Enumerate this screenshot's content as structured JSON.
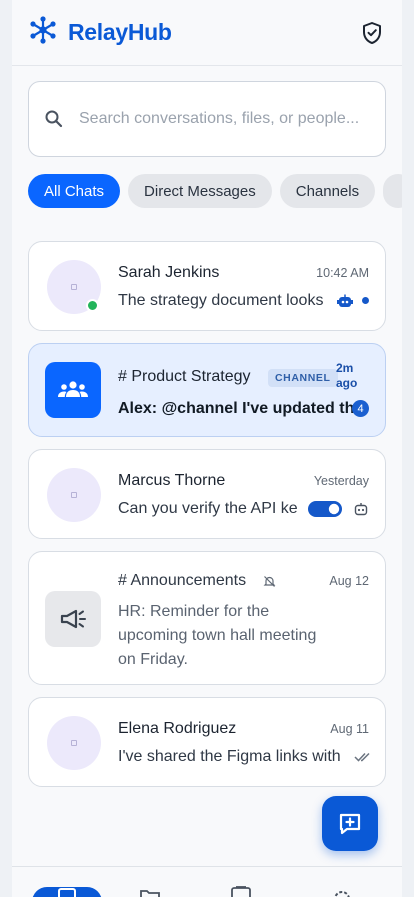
{
  "app": {
    "title": "RelayHub"
  },
  "search": {
    "placeholder": "Search conversations, files, or people..."
  },
  "filters": [
    {
      "label": "All Chats",
      "active": true
    },
    {
      "label": "Direct Messages",
      "active": false
    },
    {
      "label": "Channels",
      "active": false
    }
  ],
  "conversations": [
    {
      "name": "Sarah Jenkins",
      "time": "10:42 AM",
      "preview": "The strategy document looks",
      "online": true,
      "unread": true
    },
    {
      "name": "# Product Strategy",
      "badge": "CHANNEL",
      "time": "2m ago",
      "preview": "Alex: @channel I've updated the",
      "unread_count": "4"
    },
    {
      "name": "Marcus Thorne",
      "time": "Yesterday",
      "preview": "Can you verify the API ke"
    },
    {
      "name": "# Announcements",
      "time": "Aug 12",
      "preview_lines": [
        "HR: Reminder for the",
        "upcoming town hall meeting",
        "on Friday."
      ],
      "muted": true
    },
    {
      "name": "Elena Rodriguez",
      "time": "Aug 11",
      "preview": "I've shared the Figma links with"
    }
  ],
  "colors": {
    "brand": "#0a59d6",
    "accent": "#0a66ff",
    "online": "#22b45a"
  }
}
